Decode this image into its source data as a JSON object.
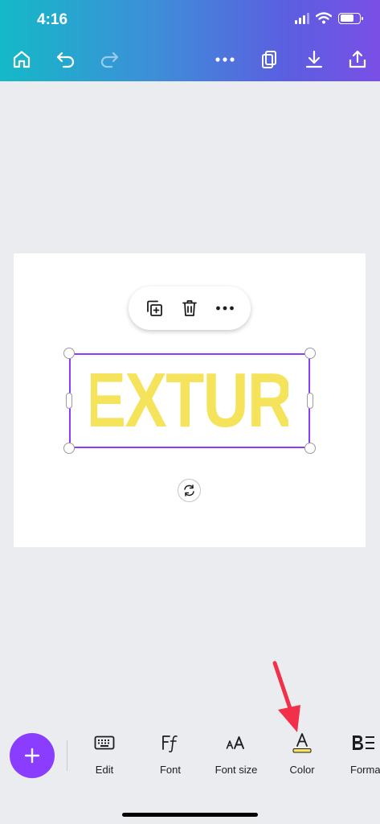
{
  "status_bar": {
    "time": "4:16"
  },
  "toolbar": {
    "home": "home-icon",
    "undo": "undo-icon",
    "redo": "redo-icon",
    "more": "more-icon",
    "pages": "pages-icon",
    "download": "download-icon",
    "share": "share-icon"
  },
  "canvas": {
    "text_element": "TEXTURE",
    "text_color": "#f5e35c",
    "selection_color": "#8b3dff"
  },
  "context_menu": {
    "duplicate": "duplicate-icon",
    "delete": "trash-icon",
    "more": "more-icon"
  },
  "bottom_toolbar": {
    "add": "plus-icon",
    "items": [
      {
        "label": "Edit",
        "icon": "keyboard-icon"
      },
      {
        "label": "Font",
        "icon": "font-icon"
      },
      {
        "label": "Font size",
        "icon": "font-size-icon"
      },
      {
        "label": "Color",
        "icon": "text-color-icon"
      },
      {
        "label": "Forma",
        "icon": "format-icon"
      }
    ]
  },
  "colors": {
    "accent": "#8b3dff",
    "annotation_arrow": "#f2304a"
  }
}
